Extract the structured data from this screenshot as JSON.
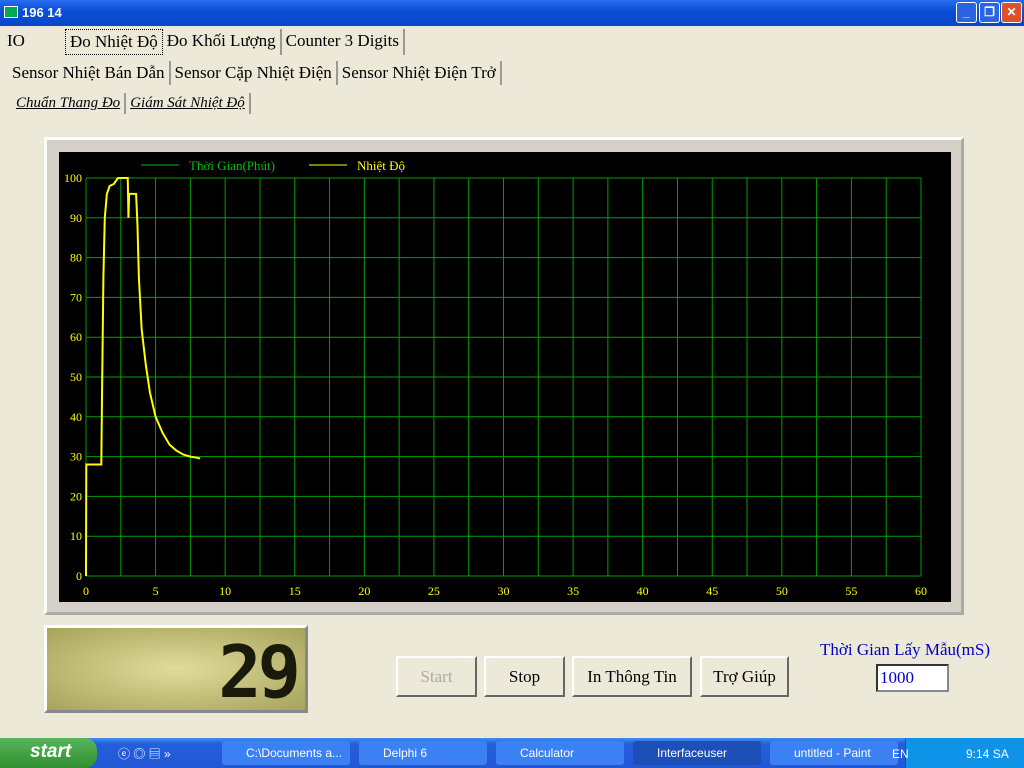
{
  "window": {
    "title": "196   14"
  },
  "tabs_main": [
    "IO",
    "Đo Nhiệt Độ",
    "Đo Khối Lượng",
    "Counter 3 Digits"
  ],
  "tabs_sensor": [
    "Sensor  Nhiệt Bán Dẫn",
    "Sensor Cặp Nhiệt Điện",
    "Sensor Nhiệt Điện Trở"
  ],
  "tabs_view": [
    "Chuẩn Thang Đo",
    "Giám Sát Nhiệt Độ"
  ],
  "chart_data": {
    "type": "line",
    "legend": [
      "Thời Gian(Phút)",
      "Nhiệt Độ"
    ],
    "legend_colors": [
      "#00c000",
      "#ffff00"
    ],
    "xlim": [
      0,
      60
    ],
    "ylim": [
      0,
      100
    ],
    "xticks": [
      "0",
      "5",
      "10",
      "15",
      "20",
      "25",
      "30",
      "35",
      "40",
      "45",
      "50",
      "55",
      "60"
    ],
    "yticks": [
      "0",
      "10",
      "20",
      "30",
      "40",
      "50",
      "60",
      "70",
      "80",
      "90",
      "100"
    ],
    "grid": true,
    "series": [
      {
        "name": "Nhiệt Độ",
        "color": "#ffff00",
        "x": [
          0,
          0.02,
          1.0,
          1.1,
          1.15,
          1.25,
          1.35,
          1.5,
          1.7,
          2.0,
          2.3,
          2.5,
          2.8,
          3.0,
          3.05,
          3.1,
          3.2,
          3.6,
          3.7,
          3.8,
          4.0,
          4.3,
          4.6,
          5.0,
          5.5,
          6.0,
          6.5,
          7.0,
          7.5,
          8.0,
          8.2
        ],
        "y": [
          0,
          28,
          28,
          28,
          45,
          75,
          90,
          96,
          98,
          98.5,
          100,
          100,
          100,
          100,
          90,
          96,
          96,
          96,
          88,
          75,
          62,
          53,
          46,
          40,
          36,
          33,
          31.5,
          30.5,
          30,
          29.7,
          29.5
        ]
      }
    ]
  },
  "display": {
    "value": "29"
  },
  "buttons": {
    "start": "Start",
    "stop": "Stop",
    "print": "In Thông Tin",
    "help": "Trợ Giúp"
  },
  "sampling": {
    "label": "Thời Gian Lấy Mẫu(mS)",
    "value": "1000"
  },
  "taskbar": {
    "start": "start",
    "items": [
      "C:\\Documents a...",
      "Delphi 6",
      "Calculator",
      "Interfaceuser",
      "untitled - Paint"
    ],
    "lang": "EN",
    "clock": "9:14 SA"
  }
}
